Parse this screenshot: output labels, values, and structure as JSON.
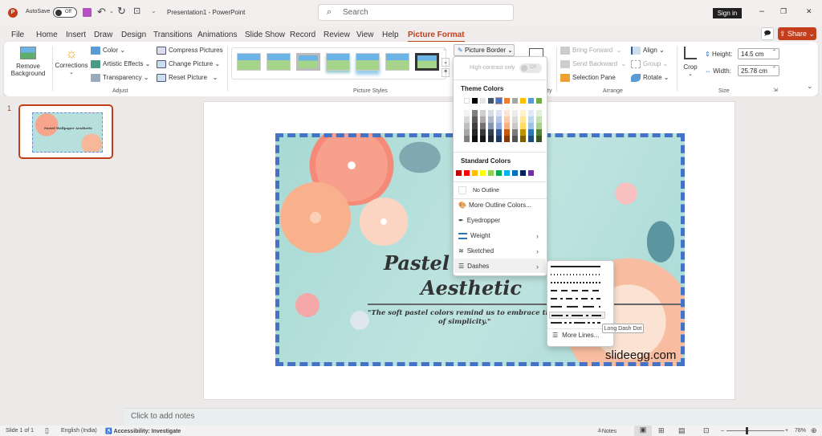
{
  "titlebar": {
    "autosave_label": "AutoSave",
    "autosave_state": "Off",
    "doc_title": "Presentation1  -  PowerPoint",
    "search_placeholder": "Search",
    "signin": "Sign in",
    "minimize": "–",
    "restore": "❐",
    "close": "✕"
  },
  "tabs": [
    "File",
    "Home",
    "Insert",
    "Draw",
    "Design",
    "Transitions",
    "Animations",
    "Slide Show",
    "Record",
    "Review",
    "View",
    "Help",
    "Picture Format"
  ],
  "active_tab": "Picture Format",
  "share_label": "Share",
  "ribbon": {
    "adjust": {
      "remove_bg": [
        "Remove",
        "Background"
      ],
      "corrections": "Corrections",
      "color": "Color",
      "artistic": "Artistic Effects",
      "transparency": "Transparency",
      "compress": "Compress Pictures",
      "change": "Change Picture",
      "reset": "Reset Picture",
      "group_label": "Adjust"
    },
    "styles": {
      "group_label": "Picture Styles",
      "picture_border": "Picture Border",
      "accessibility_suffix": "ty"
    },
    "arrange": {
      "bring_forward": "Bring Forward",
      "send_backward": "Send Backward",
      "selection_pane": "Selection Pane",
      "align": "Align",
      "group": "Group",
      "rotate": "Rotate",
      "group_label": "Arrange"
    },
    "size": {
      "crop": "Crop",
      "height_label": "Height:",
      "height_value": "14.5 cm",
      "width_label": "Width:",
      "width_value": "25.78 cm",
      "group_label": "Size"
    }
  },
  "border_menu": {
    "high_contrast": "High-contrast only",
    "high_contrast_state": "Off",
    "theme_colors_label": "Theme Colors",
    "theme_top": [
      "#ffffff",
      "#000000",
      "#e7e6e6",
      "#44546a",
      "#4472c4",
      "#ed7d31",
      "#a5a5a5",
      "#ffc000",
      "#5b9bd5",
      "#70ad47"
    ],
    "theme_shades": [
      [
        "#f2f2f2",
        "#d9d9d9",
        "#bfbfbf",
        "#a6a6a6",
        "#808080"
      ],
      [
        "#7f7f7f",
        "#595959",
        "#404040",
        "#262626",
        "#0d0d0d"
      ],
      [
        "#d0cece",
        "#aeaaaa",
        "#767171",
        "#3b3838",
        "#181717"
      ],
      [
        "#d6dce4",
        "#adb9ca",
        "#8497b0",
        "#333f4f",
        "#222a35"
      ],
      [
        "#d9e2f3",
        "#b4c7e7",
        "#8faadc",
        "#2f5597",
        "#1f3864"
      ],
      [
        "#fbe5d6",
        "#f8cbad",
        "#f4b183",
        "#c55a11",
        "#843c0c"
      ],
      [
        "#ededed",
        "#dbdbdb",
        "#c9c9c9",
        "#7b7b7b",
        "#525252"
      ],
      [
        "#fff2cc",
        "#ffe699",
        "#ffd966",
        "#bf9000",
        "#7f6000"
      ],
      [
        "#deebf7",
        "#bdd7ee",
        "#9dc3e6",
        "#2e75b6",
        "#1f4e79"
      ],
      [
        "#e2f0d9",
        "#c5e0b4",
        "#a9d18e",
        "#538135",
        "#375623"
      ]
    ],
    "standard_colors_label": "Standard Colors",
    "standard": [
      "#c00000",
      "#ff0000",
      "#ffc000",
      "#ffff00",
      "#92d050",
      "#00b050",
      "#00b0f0",
      "#0070c0",
      "#002060",
      "#7030a0"
    ],
    "no_outline": "No Outline",
    "more_colors": "More Outline Colors...",
    "eyedropper": "Eyedropper",
    "weight": "Weight",
    "sketched": "Sketched",
    "dashes": "Dashes"
  },
  "dash_menu": {
    "styles": [
      "Solid",
      "Round Dot",
      "Square Dot",
      "Dash",
      "Dash Dot",
      "Long Dash",
      "Long Dash Dot",
      "Long Dash Dot Dot"
    ],
    "more_lines": "More Lines...",
    "tooltip": "Long Dash Dot"
  },
  "slide_panel": {
    "number": "1",
    "thumb_title": "Pastel Wallpaper Aesthetic"
  },
  "slide": {
    "title_line1": "Pastel W",
    "title_line2": "Aesthetic",
    "quote_line1": "\"The soft pastel colors remind us to embrace the bea",
    "quote_line2": "of simplicity.\"",
    "watermark": "slideegg.com",
    "border_color": "#4472c4"
  },
  "notes_placeholder": "Click to add notes",
  "status": {
    "slide": "Slide 1 of 1",
    "language": "English (India)",
    "accessibility": "Accessibility: Investigate",
    "notes": "Notes",
    "zoom": "78%"
  }
}
